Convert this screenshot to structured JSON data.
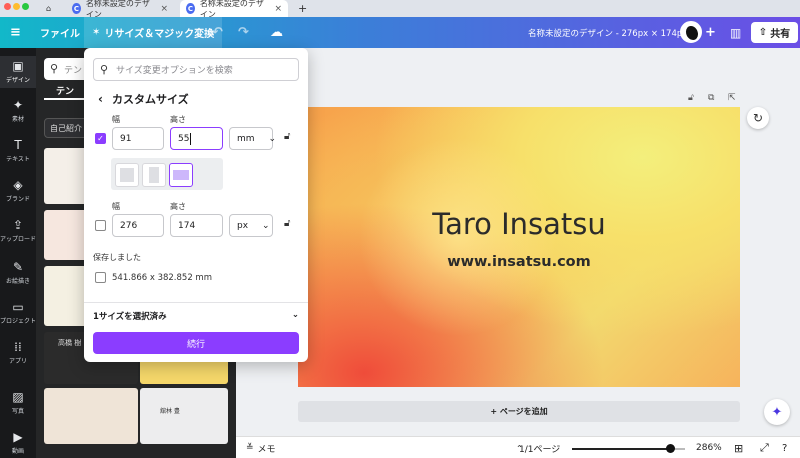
{
  "browser": {
    "tabs": [
      {
        "label": "名称未設定のデザイン",
        "favicon": "C"
      },
      {
        "label": "名称未設定のデザイン",
        "favicon": "C"
      }
    ],
    "new_tab": "+"
  },
  "header": {
    "menu_icon": "≡",
    "file_label": "ファイル",
    "resize_label": "リサイズ＆マジック変換",
    "undo": "↶",
    "redo": "↷",
    "cloud": "☁",
    "doc_title": "名称未設定のデザイン - 276px × 174px",
    "add": "+",
    "stats": "▥",
    "share_label": "共有"
  },
  "rail": {
    "items": [
      {
        "icon": "▣",
        "label": "デザイン"
      },
      {
        "icon": "✦",
        "label": "素材"
      },
      {
        "icon": "T",
        "label": "テキスト"
      },
      {
        "icon": "◈",
        "label": "ブランド"
      },
      {
        "icon": "⇪",
        "label": "アップロード"
      },
      {
        "icon": "✎",
        "label": "お絵描き"
      },
      {
        "icon": "▭",
        "label": "プロジェクト"
      },
      {
        "icon": "⁞⁞",
        "label": "アプリ"
      },
      {
        "icon": "▨",
        "label": "写真"
      },
      {
        "icon": "▶",
        "label": "動画"
      }
    ]
  },
  "side_panel": {
    "search_placeholder": "テン",
    "tab_label": "テン",
    "chip_label": "自己紹介",
    "card_text_1": "高橋 樹",
    "card_text_2": "舘林 豊"
  },
  "popover": {
    "search_placeholder": "サイズ変更オプションを検索",
    "title": "カスタムサイズ",
    "row1": {
      "width_label": "幅",
      "height_label": "高さ",
      "width": "91",
      "height": "55",
      "unit": "mm",
      "checked": true
    },
    "row2": {
      "width_label": "幅",
      "height_label": "高さ",
      "width": "276",
      "height": "174",
      "unit": "px",
      "checked": false
    },
    "saved_label": "保存しました",
    "saved_item": "541.866 x 382.852 mm",
    "selected_summary": "1サイズを選択済み",
    "continue_label": "続行"
  },
  "canvas": {
    "name_text": "Taro Insatsu",
    "web_text": "www.insatsu.com",
    "add_page_label": "+ ページを追加"
  },
  "bottom_bar": {
    "notes_label": "メモ",
    "pages_label": "1/1ページ",
    "zoom_label": "286%",
    "zoom_level_percent": 286
  },
  "colors": {
    "accent": "#8b3dff",
    "header_start": "#12b8c9",
    "header_end": "#6b4ee6"
  }
}
